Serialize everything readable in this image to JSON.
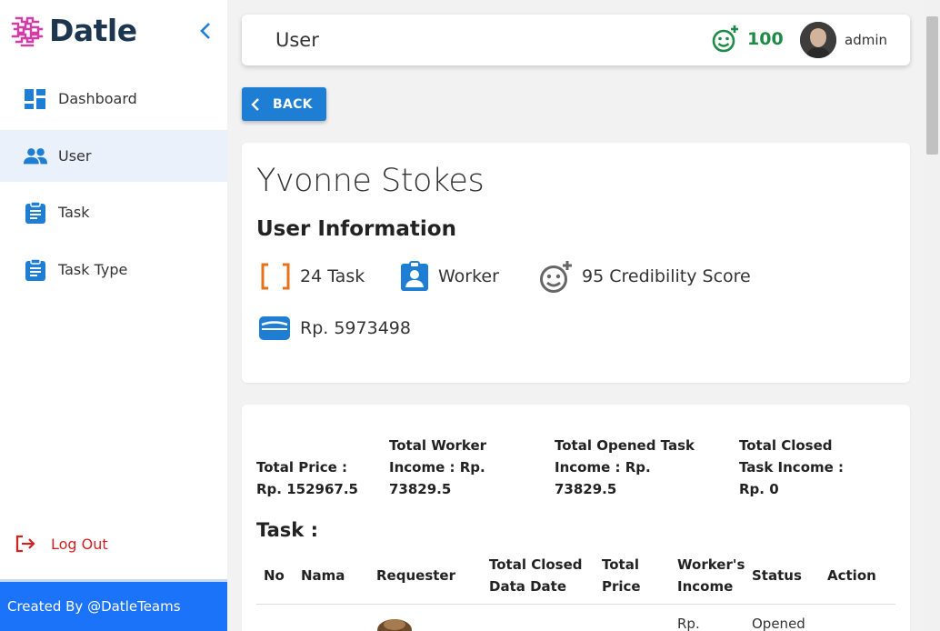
{
  "brand": {
    "name": "Datle"
  },
  "sidebar": {
    "items": [
      {
        "label": "Dashboard",
        "icon": "dashboard-icon"
      },
      {
        "label": "User",
        "icon": "users-icon"
      },
      {
        "label": "Task",
        "icon": "clipboard-icon"
      },
      {
        "label": "Task Type",
        "icon": "clipboard-icon"
      }
    ],
    "active": "User",
    "logout_label": "Log Out",
    "footer": "Created By @DatleTeams"
  },
  "topbar": {
    "title": "User",
    "score": "100",
    "user": "admin"
  },
  "back_label": "BACK",
  "user": {
    "name": "Yvonne Stokes",
    "section_title": "User Information",
    "task_count": "24 Task",
    "role": "Worker",
    "credibility": "95 Credibility Score",
    "balance": "Rp. 5973498"
  },
  "totals": [
    {
      "lines": [
        "Total Price :",
        "Rp. 152967.5"
      ]
    },
    {
      "lines": [
        "Total Worker",
        "Income : Rp.",
        "73829.5"
      ]
    },
    {
      "lines": [
        "Total Opened Task",
        "Income : Rp.",
        "73829.5"
      ]
    },
    {
      "lines": [
        "Total Closed",
        "Task Income :",
        "Rp. 0"
      ]
    }
  ],
  "task_section": {
    "title": "Task :"
  },
  "table": {
    "headers": [
      {
        "lines": [
          "No"
        ]
      },
      {
        "lines": [
          "Nama"
        ]
      },
      {
        "lines": [
          "Requester"
        ]
      },
      {
        "lines": [
          "Total Closed",
          "Data Date"
        ]
      },
      {
        "lines": [
          "Total",
          "Price"
        ]
      },
      {
        "lines": [
          "Worker's",
          "Income"
        ]
      },
      {
        "lines": [
          "Status"
        ]
      },
      {
        "lines": [
          "Action"
        ]
      }
    ],
    "first_row": {
      "income": "Rp.",
      "status": "Opened"
    }
  },
  "colors": {
    "brand": "#1c3650",
    "accent": "#1d7ed4",
    "score_green": "#1e8a46",
    "logout_red": "#d32121",
    "footer_blue": "#1a73f8",
    "task_orange": "#e8711c"
  }
}
